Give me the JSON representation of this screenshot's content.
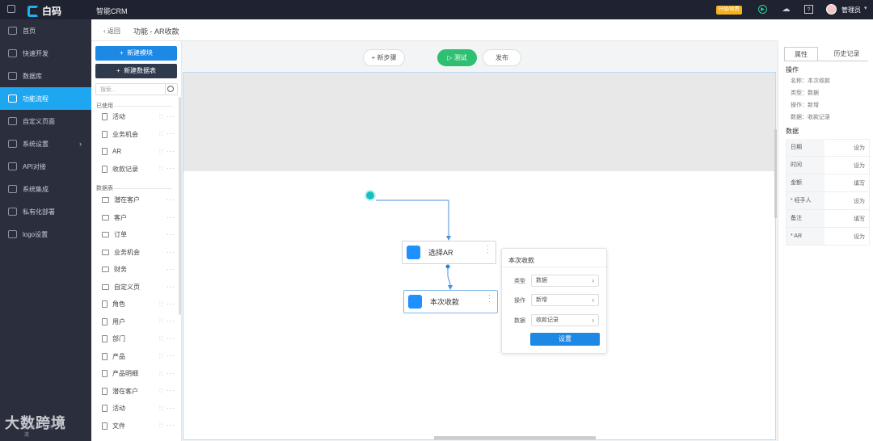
{
  "app": {
    "logo_text": "白码",
    "title": "智能CRM",
    "upgrade_badge": "升级/续费",
    "user": "管理员"
  },
  "sidebar": {
    "items": [
      {
        "label": "首页"
      },
      {
        "label": "快速开发"
      },
      {
        "label": "数据库"
      },
      {
        "label": "功能流程",
        "active": true
      },
      {
        "label": "自定义页面"
      },
      {
        "label": "系统设置",
        "has_arrow": true
      },
      {
        "label": "API对接"
      },
      {
        "label": "系统集成"
      },
      {
        "label": "私有化部署"
      },
      {
        "label": "logo设置"
      }
    ]
  },
  "watermark": {
    "text": "大数跨境",
    "small": "反馈 · 学习 · 交流"
  },
  "breadcrumb": {
    "back": "返回",
    "title": "功能 - AR收款"
  },
  "modules": {
    "new_module": "新建模块",
    "new_table": "新建数据表",
    "search_placeholder": "搜索...",
    "used_title": "已使用",
    "used": [
      "活动",
      "业务机会",
      "AR",
      "收款记录"
    ],
    "tables_title": "数据表",
    "tables": [
      {
        "label": "潜在客户",
        "type": "folder"
      },
      {
        "label": "客户",
        "type": "folder"
      },
      {
        "label": "订单",
        "type": "folder"
      },
      {
        "label": "业务机会",
        "type": "folder"
      },
      {
        "label": "财务",
        "type": "folder"
      },
      {
        "label": "自定义页",
        "type": "folder"
      },
      {
        "label": "角色",
        "type": "file"
      },
      {
        "label": "用户",
        "type": "file"
      },
      {
        "label": "部门",
        "type": "file"
      },
      {
        "label": "产品",
        "type": "file"
      },
      {
        "label": "产品明细",
        "type": "file"
      },
      {
        "label": "潜在客户",
        "type": "file"
      },
      {
        "label": "活动",
        "type": "file"
      },
      {
        "label": "文件",
        "type": "file"
      }
    ]
  },
  "toolbar": {
    "new_step": "+ 新步骤",
    "test": "▷ 测试",
    "publish": "发布"
  },
  "flow": {
    "nodes": [
      {
        "label": "选择AR"
      },
      {
        "label": "本次收款"
      }
    ]
  },
  "popover": {
    "title": "本次收款",
    "rows": [
      {
        "label": "类型",
        "value": "数据"
      },
      {
        "label": "操作",
        "value": "新增"
      },
      {
        "label": "数据",
        "value": "收款记录"
      }
    ],
    "button": "设置"
  },
  "right_panel": {
    "tabs": [
      "属性",
      "历史记录"
    ],
    "operation_title": "操作",
    "operation": [
      "名称：本次收款",
      "类型：数据",
      "操作：新增",
      "数据：收款记录"
    ],
    "data_title": "数据",
    "data_rows": [
      {
        "label": "日期",
        "action": "设为"
      },
      {
        "label": "时间",
        "action": "设为"
      },
      {
        "label": "金额",
        "action": "填写"
      },
      {
        "label": "* 经手人",
        "action": "设为"
      },
      {
        "label": "备注",
        "action": "填写"
      },
      {
        "label": "* AR",
        "action": "设为"
      }
    ]
  },
  "colors": {
    "accent": "#1e88e5",
    "sidebar_active": "#1ea7f0",
    "test_green": "#2fbf71",
    "start_node": "#18c1c1"
  }
}
